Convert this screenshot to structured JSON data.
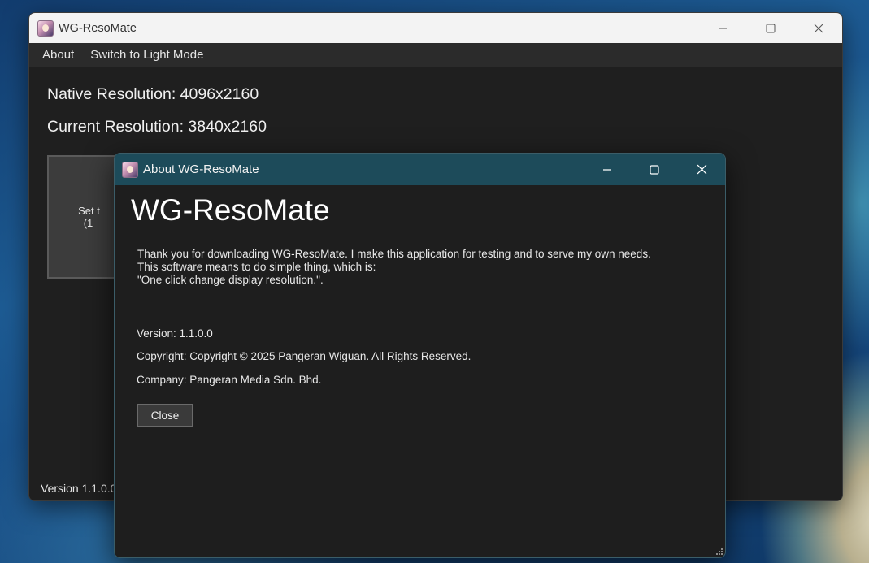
{
  "main_window": {
    "title": "WG-ResoMate",
    "menu": [
      {
        "label": "About"
      },
      {
        "label": "Switch to Light Mode"
      }
    ],
    "native_resolution": "Native Resolution: 4096x2160",
    "current_resolution": "Current Resolution: 3840x2160",
    "set_button": {
      "line1": "Set t",
      "line2": "(1"
    },
    "footer_version": "Version 1.1.0.0"
  },
  "about_dialog": {
    "title": "About WG-ResoMate",
    "app_name": "WG-ResoMate",
    "description": [
      "Thank you for downloading WG-ResoMate. I make this application for testing and to serve my own needs.",
      "This software means to do simple thing, which is:",
      "\"One click change display resolution.\"."
    ],
    "version": "Version: 1.1.0.0",
    "copyright": "Copyright: Copyright ©  2025 Pangeran Wiguan. All Rights Reserved.",
    "company": "Company: Pangeran Media Sdn. Bhd.",
    "close_label": "Close"
  },
  "icons": {
    "app": "app-icon",
    "minimize": "minimize-icon",
    "maximize": "maximize-icon",
    "close": "close-icon",
    "resize_grip": "resize-grip-icon"
  },
  "colors": {
    "main_bg": "#1f1f1f",
    "dialog_titlebar": "#1d4b5a",
    "main_titlebar": "#f3f3f3"
  }
}
